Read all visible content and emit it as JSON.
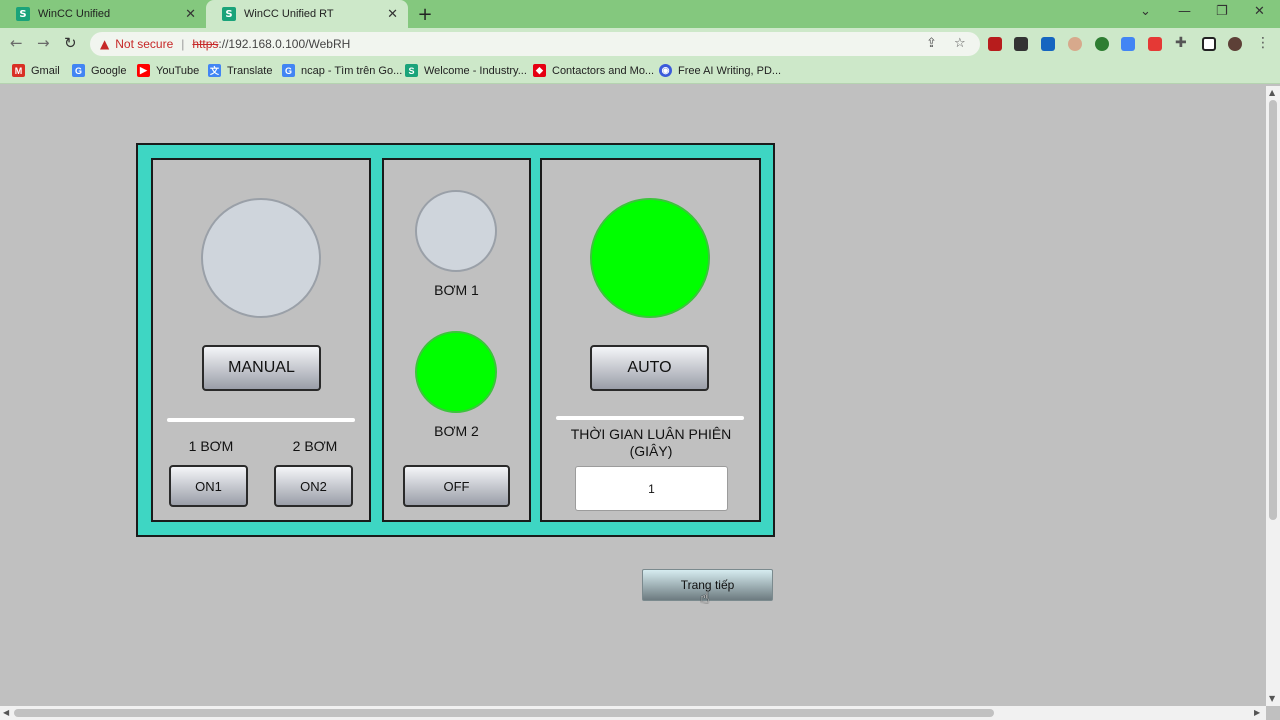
{
  "browser": {
    "tabs": [
      {
        "title": "WinCC Unified",
        "icon": "S"
      },
      {
        "title": "WinCC Unified RT",
        "icon": "S"
      }
    ],
    "new_tab": "+",
    "window_controls": {
      "minimize": "—",
      "restore": "❐",
      "close": "✕"
    },
    "address": {
      "warning": "Not secure",
      "scheme": "https",
      "host_path": "://192.168.0.100/WebRH"
    },
    "bookmarks": [
      {
        "label": "Gmail",
        "icon": "gmail-icon",
        "color": "#d93025",
        "glyph": "M"
      },
      {
        "label": "Google",
        "icon": "google-icon",
        "color": "#4285f4",
        "glyph": "G"
      },
      {
        "label": "YouTube",
        "icon": "youtube-icon",
        "color": "#ff0000",
        "glyph": "▶"
      },
      {
        "label": "Translate",
        "icon": "translate-icon",
        "color": "#4285f4",
        "glyph": "文"
      },
      {
        "label": "ncap - Tìm trên Go...",
        "icon": "google-icon",
        "color": "#4285f4",
        "glyph": "G"
      },
      {
        "label": "Welcome - Industry...",
        "icon": "siemens-icon",
        "color": "#1aa37a",
        "glyph": "S"
      },
      {
        "label": "Contactors and Mo...",
        "icon": "mitsubishi-icon",
        "color": "#e60012",
        "glyph": "◆"
      },
      {
        "label": "Free AI Writing, PD...",
        "icon": "ai-writing-icon",
        "color": "#3b5bdb",
        "glyph": "◉"
      }
    ]
  },
  "hmi": {
    "manual": {
      "button_label": "MANUAL",
      "lamp_on": false
    },
    "pump_select": {
      "label_1": "1 BƠM",
      "label_2": "2 BƠM",
      "on1": "ON1",
      "on2": "ON2"
    },
    "pumps": {
      "pump1_label": "BƠM 1",
      "pump1_on": false,
      "pump2_label": "BƠM 2",
      "pump2_on": true,
      "off_button": "OFF"
    },
    "auto": {
      "button_label": "AUTO",
      "lamp_on": true,
      "rotation_label": "THỜI GIAN LUÂN PHIÊN (GIÂY)",
      "rotation_value": "1"
    },
    "next_page_button": "Trang tiếp"
  },
  "colors": {
    "frame": "#3ed6c3",
    "lamp_on": "#00ff00",
    "lamp_off": "#cfd5dc",
    "background": "#c0c0c0"
  }
}
